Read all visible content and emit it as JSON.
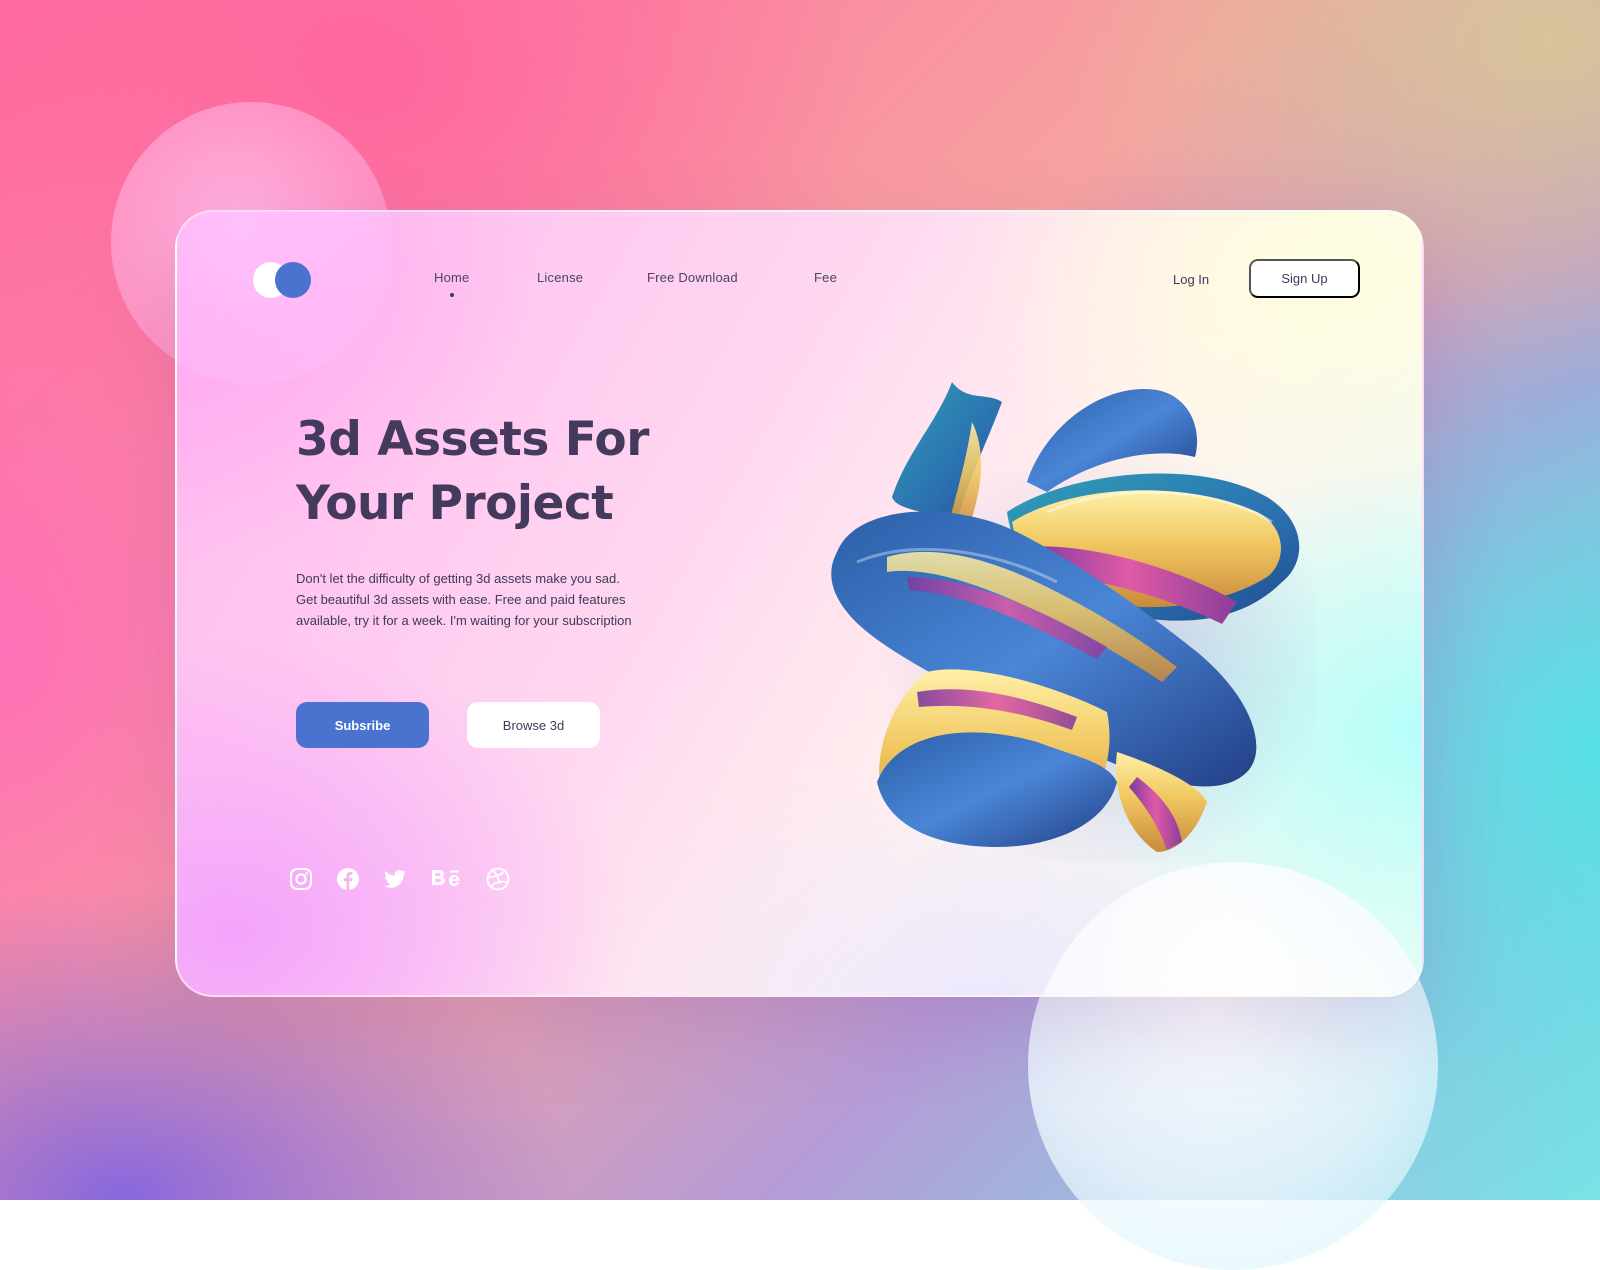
{
  "brand": {
    "logo_colors": [
      "#ffffff",
      "#4a72cf"
    ]
  },
  "nav": {
    "items": [
      {
        "label": "Home",
        "active": true
      },
      {
        "label": "License",
        "active": false
      },
      {
        "label": "Free Download",
        "active": false
      },
      {
        "label": "Fee",
        "active": false
      }
    ],
    "login_label": "Log In",
    "signup_label": "Sign Up"
  },
  "hero": {
    "headline_line1": "3d Assets For",
    "headline_line2": "Your Project",
    "description": "Don't let the difficulty of getting 3d assets make you sad. Get beautiful 3d assets with ease. Free and paid features available, try it for a week. I'm waiting for your subscription",
    "primary_button": "Subsribe",
    "secondary_button": "Browse 3d"
  },
  "socials": [
    {
      "icon": "instagram-icon"
    },
    {
      "icon": "facebook-icon"
    },
    {
      "icon": "twitter-icon"
    },
    {
      "icon": "behance-icon"
    },
    {
      "icon": "dribbble-icon"
    }
  ],
  "colors": {
    "accent": "#4a72cf",
    "text_dark": "#443a5e",
    "button_light": "#ffffff"
  }
}
